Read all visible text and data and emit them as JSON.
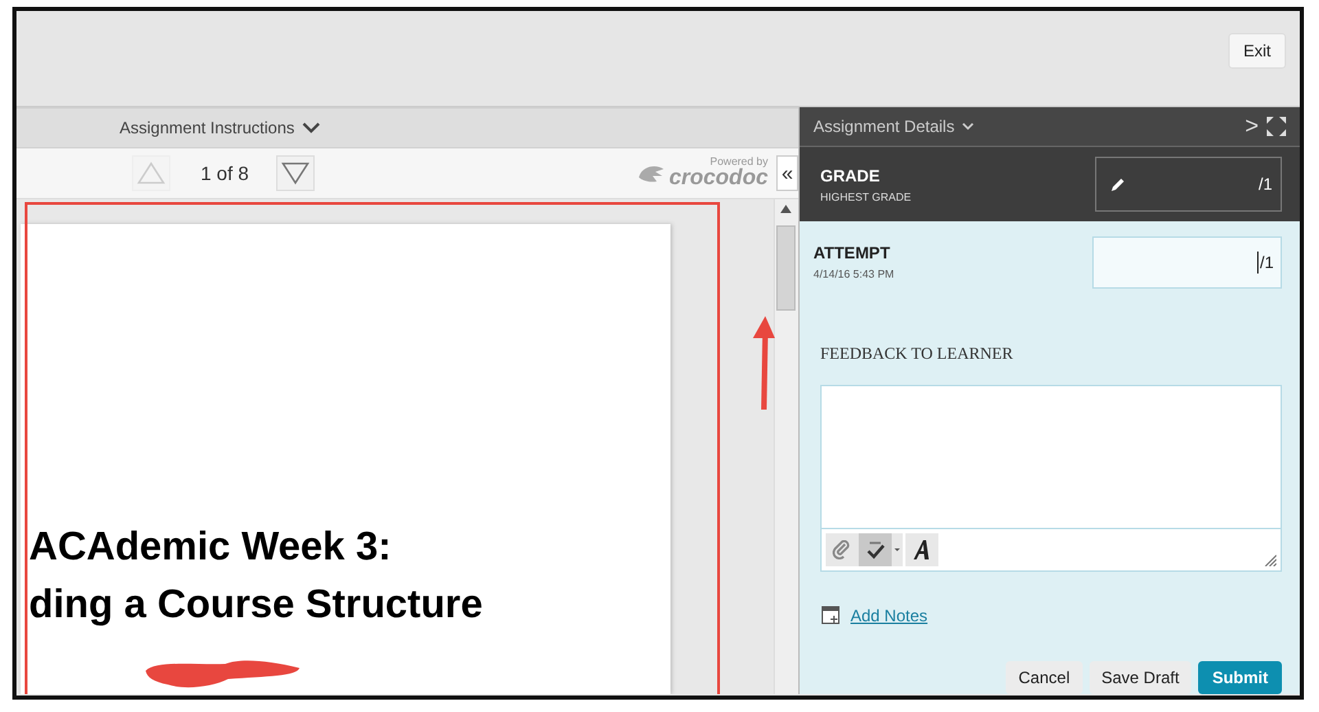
{
  "top_bar": {
    "exit_button": "Exit"
  },
  "viewer": {
    "instructions_label": "Assignment Instructions",
    "pager": {
      "previous_disabled": true,
      "next_disabled": false,
      "page_label": "1 of 8"
    },
    "branding": {
      "caption": "Powered by",
      "name": "crocodoc"
    },
    "collapse_button": "«",
    "document_lines": [
      "ACAdemic Week 3:",
      "ding a Course Structure"
    ]
  },
  "panel": {
    "title": "Assignment Details",
    "expand_button": ">",
    "grade": {
      "label": "GRADE",
      "sublabel": "HIGHEST GRADE",
      "out_of": "/1"
    },
    "attempt": {
      "label": "ATTEMPT",
      "date": "4/14/16 5:43 PM",
      "out_of": "/1"
    },
    "feedback_label": "FEEDBACK TO LEARNER",
    "spellcheck_on": true,
    "add_notes_link": "Add Notes",
    "buttons": [
      {
        "label": "Cancel",
        "kind": "secondary"
      },
      {
        "label": "Save Draft",
        "kind": "secondary"
      },
      {
        "label": "Submit",
        "kind": "primary"
      }
    ]
  }
}
